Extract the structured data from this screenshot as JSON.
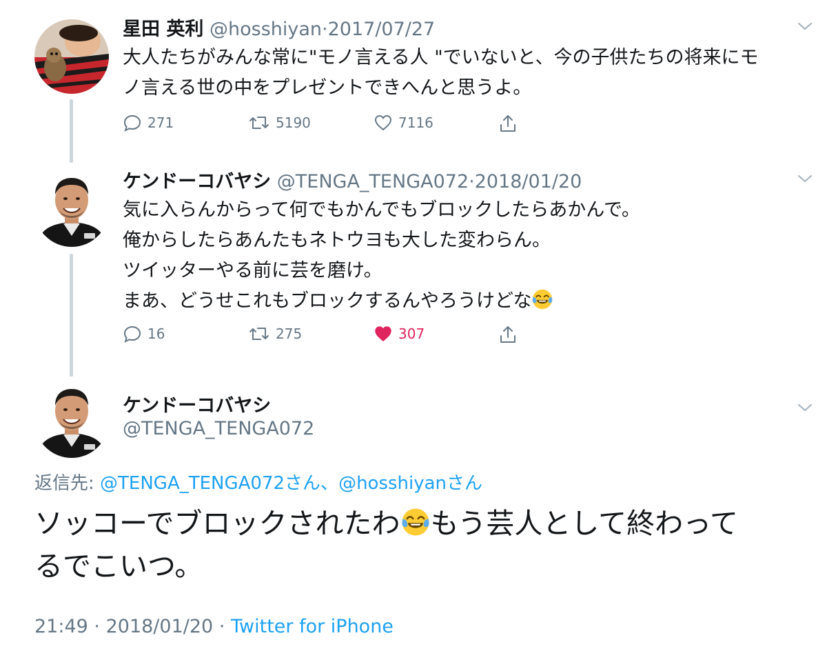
{
  "colors": {
    "text": "#14171a",
    "secondary": "#657786",
    "link": "#1da1f2",
    "like": "#e0245e",
    "thread_line": "#ccd6dd"
  },
  "tweets": [
    {
      "name": "星田 英利",
      "handle": "@hosshiyan",
      "sep": "·",
      "date": "2017/07/27",
      "text_lines": [
        "大人たちがみんな常に\"モノ言える人 \"でいないと、今の子供たちの将来にモ",
        "ノ言える世の中をプレゼントできへんと思うよ。"
      ],
      "replies": "271",
      "retweets": "5190",
      "likes": "7116",
      "liked": false
    },
    {
      "name": "ケンドーコバヤシ",
      "handle": "@TENGA_TENGA072",
      "sep": "·",
      "date": "2018/01/20",
      "text_lines": [
        "気に入らんからって何でもかんでもブロックしたらあかんで。",
        "俺からしたらあんたもネトウヨも大した変わらん。",
        "ツイッターやる前に芸を磨け。",
        "まあ、どうせこれもブロックするんやろうけどな"
      ],
      "last_line_emoji": "face-with-tears-of-joy-emoji",
      "replies": "16",
      "retweets": "275",
      "likes": "307",
      "liked": true
    }
  ],
  "main_tweet": {
    "name": "ケンドーコバヤシ",
    "handle": "@TENGA_TENGA072",
    "reply_label": "返信先:",
    "reply_to_1": "@TENGA_TENGA072さん",
    "reply_sep": "、",
    "reply_to_2": "@hosshiyanさん",
    "text_line1_a": "ソッコーでブロックされたわ",
    "text_line1_b": "もう芸人として終わって",
    "text_line2": "るでこいつ。",
    "time": "21:49",
    "sep": "·",
    "date": "2018/01/20",
    "source": "Twitter for iPhone"
  },
  "icons": {
    "reply": "reply-bubble-icon",
    "retweet": "retweet-icon",
    "like": "heart-icon",
    "share": "share-icon",
    "menu": "chevron-down-icon"
  }
}
